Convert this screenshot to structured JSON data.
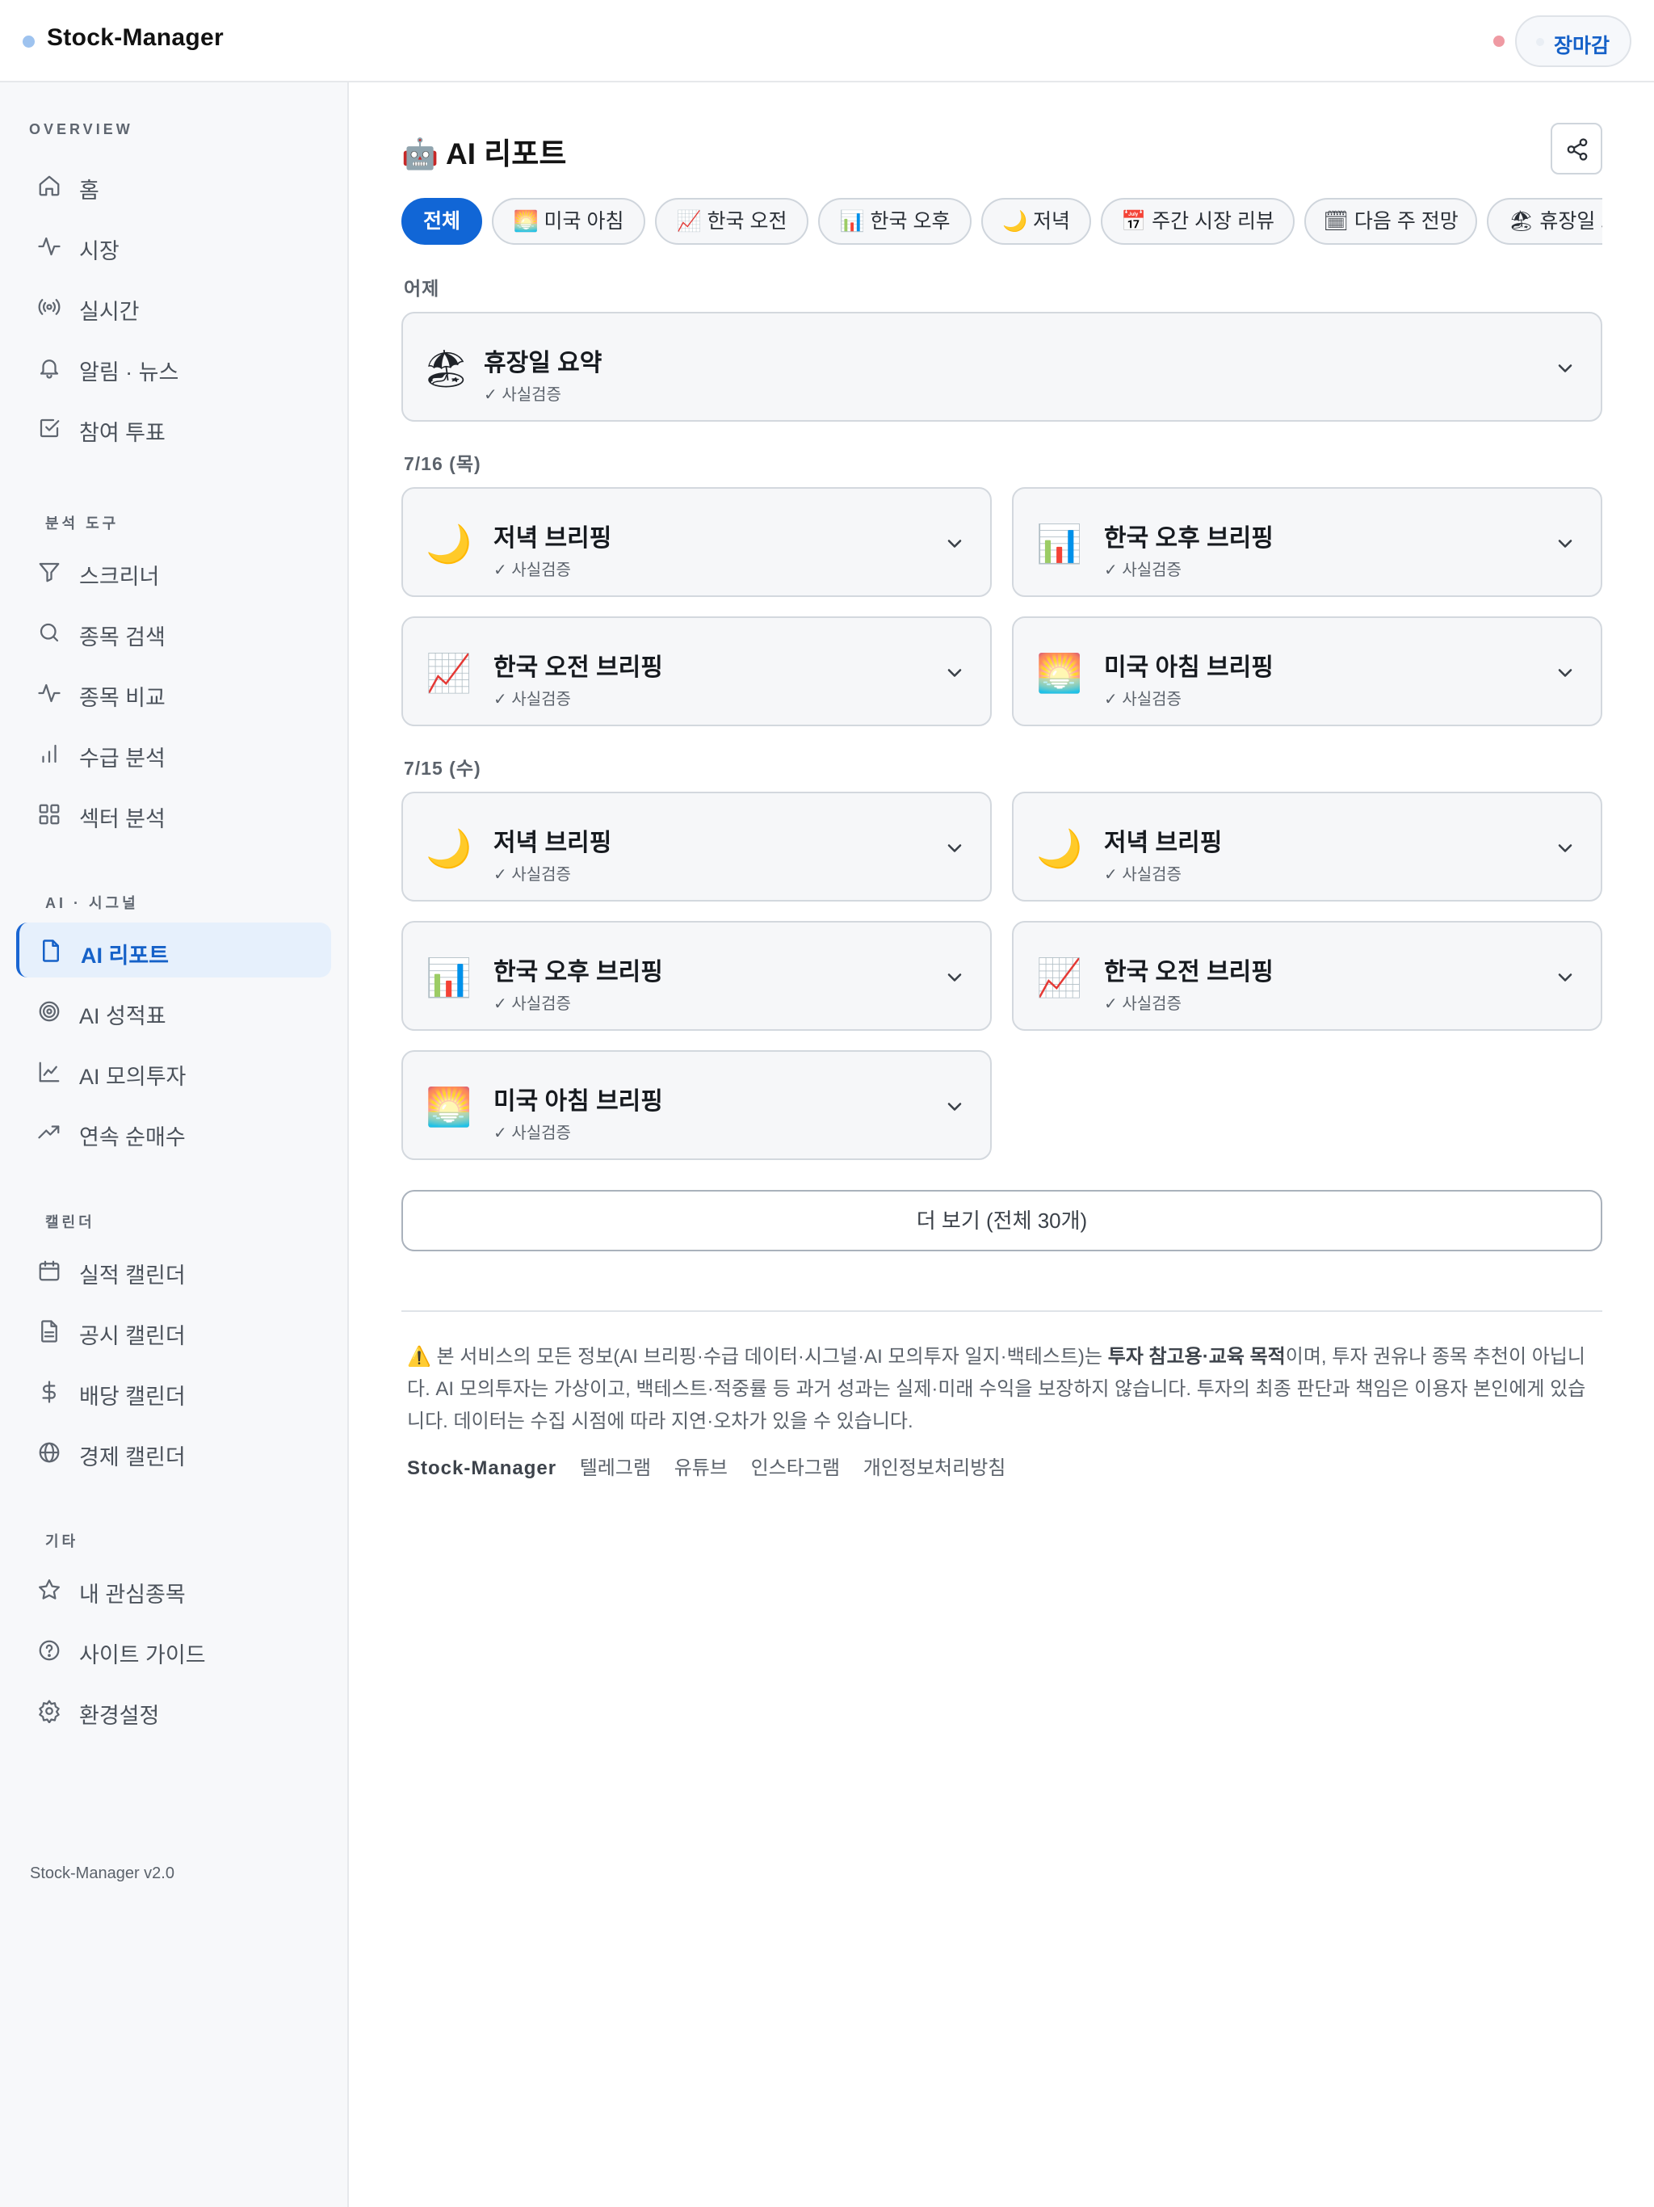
{
  "app": {
    "name": "Stock-Manager",
    "market_status": "장마감",
    "version": "Stock-Manager v2.0"
  },
  "sidebar": {
    "sections": [
      {
        "title": "OVERVIEW",
        "items": [
          {
            "label": "홈",
            "icon": "home-icon"
          },
          {
            "label": "시장",
            "icon": "activity-icon"
          },
          {
            "label": "실시간",
            "icon": "broadcast-icon"
          },
          {
            "label": "알림 · 뉴스",
            "icon": "bell-icon"
          },
          {
            "label": "참여 투표",
            "icon": "checkbox-icon"
          }
        ]
      },
      {
        "title": "분석 도구",
        "items": [
          {
            "label": "스크리너",
            "icon": "filter-icon"
          },
          {
            "label": "종목 검색",
            "icon": "search-icon"
          },
          {
            "label": "종목 비교",
            "icon": "activity-icon"
          },
          {
            "label": "수급 분석",
            "icon": "bar-chart-icon"
          },
          {
            "label": "섹터 분석",
            "icon": "grid-icon"
          }
        ]
      },
      {
        "title": "AI · 시그널",
        "items": [
          {
            "label": "AI 리포트",
            "icon": "document-icon",
            "active": true
          },
          {
            "label": "AI 성적표",
            "icon": "target-icon"
          },
          {
            "label": "AI 모의투자",
            "icon": "line-chart-icon"
          },
          {
            "label": "연속 순매수",
            "icon": "trending-up-icon"
          }
        ]
      },
      {
        "title": "캘린더",
        "items": [
          {
            "label": "실적 캘린더",
            "icon": "calendar-icon"
          },
          {
            "label": "공시 캘린더",
            "icon": "file-text-icon"
          },
          {
            "label": "배당 캘린더",
            "icon": "dollar-icon"
          },
          {
            "label": "경제 캘린더",
            "icon": "globe-icon"
          }
        ]
      },
      {
        "title": "기타",
        "items": [
          {
            "label": "내 관심종목",
            "icon": "star-icon"
          },
          {
            "label": "사이트 가이드",
            "icon": "help-circle-icon"
          },
          {
            "label": "환경설정",
            "icon": "gear-icon"
          }
        ]
      }
    ]
  },
  "main": {
    "title": "🤖 AI 리포트",
    "tabs": [
      {
        "label": "전체",
        "active": true
      },
      {
        "label": "🌅 미국 아침"
      },
      {
        "label": "📈 한국 오전"
      },
      {
        "label": "📊 한국 오후"
      },
      {
        "label": "🌙 저녁"
      },
      {
        "label": "📅 주간 시장 리뷰"
      },
      {
        "label": "🗓 다음 주 전망"
      },
      {
        "label": "🏖 휴장일 요약"
      }
    ],
    "groups": [
      {
        "label": "어제",
        "reports": [
          {
            "emoji": "🏖",
            "title": "휴장일 요약",
            "subtitle": "✓ 사실검증"
          }
        ]
      },
      {
        "label": "7/16 (목)",
        "reports": [
          {
            "emoji": "🌙",
            "title": "저녁 브리핑",
            "subtitle": "✓ 사실검증"
          },
          {
            "emoji": "📊",
            "title": "한국 오후 브리핑",
            "subtitle": "✓ 사실검증"
          },
          {
            "emoji": "📈",
            "title": "한국 오전 브리핑",
            "subtitle": "✓ 사실검증"
          },
          {
            "emoji": "🌅",
            "title": "미국 아침 브리핑",
            "subtitle": "✓ 사실검증"
          }
        ]
      },
      {
        "label": "7/15 (수)",
        "reports": [
          {
            "emoji": "🌙",
            "title": "저녁 브리핑",
            "subtitle": "✓ 사실검증"
          },
          {
            "emoji": "🌙",
            "title": "저녁 브리핑",
            "subtitle": "✓ 사실검증"
          },
          {
            "emoji": "📊",
            "title": "한국 오후 브리핑",
            "subtitle": "✓ 사실검증"
          },
          {
            "emoji": "📈",
            "title": "한국 오전 브리핑",
            "subtitle": "✓ 사실검증"
          },
          {
            "emoji": "🌅",
            "title": "미국 아침 브리핑",
            "subtitle": "✓ 사실검증"
          }
        ]
      }
    ],
    "more_button": "더 보기 (전체 30개)"
  },
  "footer": {
    "disclaimer_prefix": "⚠️ 본 서비스의 모든 정보(AI 브리핑·수급 데이터·시그널·AI 모의투자 일지·백테스트)는 ",
    "disclaimer_bold": "투자 참고용·교육 목적",
    "disclaimer_suffix": "이며, 투자 권유나 종목 추천이 아닙니다. AI 모의투자는 가상이고, 백테스트·적중률 등 과거 성과는 실제·미래 수익을 보장하지 않습니다. 투자의 최종 판단과 책임은 이용자 본인에게 있습니다. 데이터는 수집 시점에 따라 지연·오차가 있을 수 있습니다.",
    "links": [
      "Stock-Manager",
      "텔레그램",
      "유튜브",
      "인스타그램",
      "개인정보처리방침"
    ]
  },
  "colors": {
    "accent": "#1166d6",
    "active_bg": "#e6f0fc",
    "card_bg": "#f6f7f9",
    "border": "#d3d8de"
  }
}
